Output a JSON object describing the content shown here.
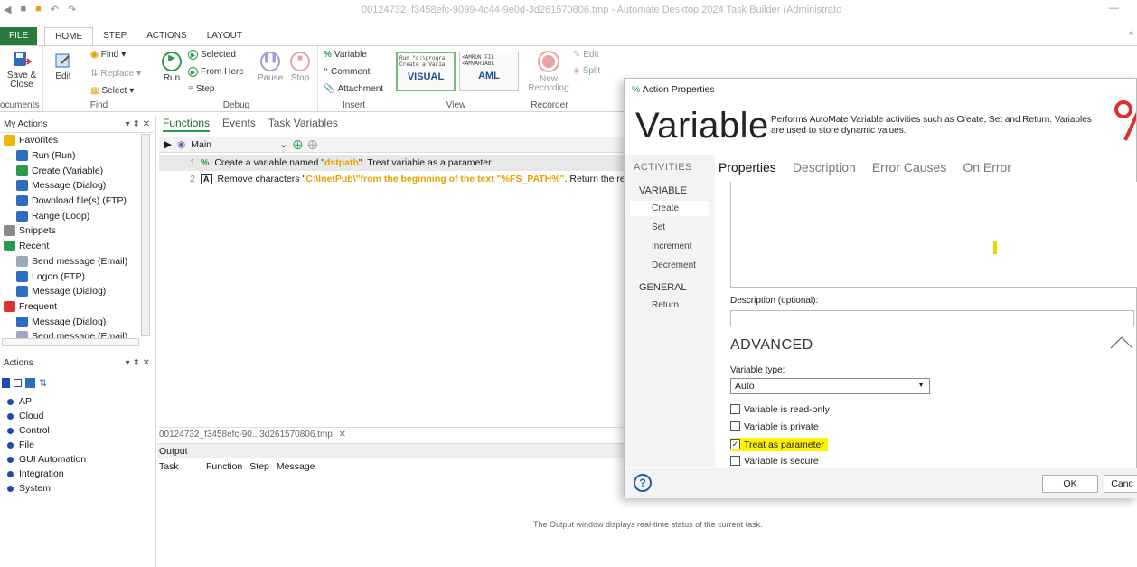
{
  "window": {
    "title": "00124732_f3458efc-9099-4c44-9e0d-3d261570806.tmp - Automate Desktop 2024 Task Builder (Administrator)",
    "minimize_glyph": "—"
  },
  "ribbon": {
    "tabs": [
      "FILE",
      "HOME",
      "STEP",
      "ACTIONS",
      "LAYOUT"
    ],
    "active_tab": "HOME",
    "collapse_glyph": "^",
    "documents": {
      "save_label": "Save &\nClose",
      "label": "ocuments"
    },
    "find": {
      "edit_label": "Edit",
      "find_label": "Find",
      "replace_label": "Replace",
      "select_label": "Select",
      "label": "Find"
    },
    "debug": {
      "run_label": "Run",
      "selected_label": "Selected",
      "from_here_label": "From Here",
      "step_label": "Step",
      "pause_label": "Pause",
      "stop_label": "Stop",
      "label": "Debug"
    },
    "insert": {
      "variable_label": "Variable",
      "comment_label": "Comment",
      "attachment_label": "Attachment",
      "label": "Insert"
    },
    "view": {
      "visual_snippet1": "Run \"c:\\progra",
      "visual_snippet2": "Create a Varia",
      "visual_label": "VISUAL",
      "aml_snippet1": "<AMRUN FIL",
      "aml_snippet2": "<AMVARIABL",
      "aml_label": "AML",
      "label": "View"
    },
    "recorder": {
      "new_label": "New\nRecording",
      "edit_label": "Edit",
      "split_label": "Split",
      "label": "Recorder"
    }
  },
  "my_actions": {
    "title": "My Actions",
    "pin_glyphs": "▾ ⬍ ✕",
    "items": [
      {
        "label": "Favorites",
        "level": 1,
        "icon": "star-icon"
      },
      {
        "label": "Run (Run)",
        "level": 2,
        "icon": "run-icon"
      },
      {
        "label": "Create (Variable)",
        "level": 2,
        "icon": "variable-icon"
      },
      {
        "label": "Message (Dialog)",
        "level": 2,
        "icon": "dialog-icon"
      },
      {
        "label": "Download file(s) (FTP)",
        "level": 2,
        "icon": "ftp-icon"
      },
      {
        "label": "Range (Loop)",
        "level": 2,
        "icon": "loop-icon"
      },
      {
        "label": "Snippets",
        "level": 1,
        "icon": "snippet-icon"
      },
      {
        "label": "Recent",
        "level": 1,
        "icon": "history-icon"
      },
      {
        "label": "Send message (Email)",
        "level": 2,
        "icon": "email-icon"
      },
      {
        "label": "Logon (FTP)",
        "level": 2,
        "icon": "ftp-icon"
      },
      {
        "label": "Message (Dialog)",
        "level": 2,
        "icon": "dialog-icon"
      },
      {
        "label": "Frequent",
        "level": 1,
        "icon": "pin-icon"
      },
      {
        "label": "Message (Dialog)",
        "level": 2,
        "icon": "dialog-icon"
      },
      {
        "label": "Send message (Email)",
        "level": 2,
        "icon": "email-icon"
      }
    ]
  },
  "actions_panel": {
    "title": "Actions",
    "items": [
      "API",
      "Cloud",
      "Control",
      "File",
      "GUI Automation",
      "Integration",
      "System"
    ]
  },
  "functions": {
    "tabs": [
      "Functions",
      "Events",
      "Task Variables"
    ],
    "active_tab": "Functions",
    "main_label": "Main",
    "steps": [
      {
        "num": "1",
        "pre": "Create a variable named \"",
        "highlight": "dstpath",
        "post": "\". Treat variable as a parameter."
      },
      {
        "num": "2",
        "pre": "Remove characters \"",
        "highlight": "C:\\InetPub\\\"from the beginning of the text \"%FS_PATH%\"",
        "post": ". Return the result t"
      }
    ],
    "doc_tab": "00124732_f3458efc-90...3d261570806.tmp"
  },
  "output": {
    "title": "Output",
    "columns": [
      "Task",
      "Function",
      "Step",
      "Message"
    ],
    "empty_message": "The Output window displays real-time status of the current task."
  },
  "dialog": {
    "title": "Action Properties",
    "heading": "Variable",
    "description": "Performs AutoMate Variable activities such as Create, Set and Return. Variables are used to store dynamic values.",
    "activities_header": "ACTIVITIES",
    "sections": [
      {
        "name": "VARIABLE",
        "items": [
          "Create",
          "Set",
          "Increment",
          "Decrement"
        ]
      },
      {
        "name": "GENERAL",
        "items": [
          "Return"
        ]
      }
    ],
    "selected_activity": "Create",
    "tabs": [
      "Properties",
      "Description",
      "Error Causes",
      "On Error"
    ],
    "active_tab": "Properties",
    "description_label": "Description (optional):",
    "description_value": "",
    "advanced_label": "ADVANCED",
    "variable_type_label": "Variable type:",
    "variable_type_value": "Auto",
    "checkboxes": [
      {
        "label": "Variable is read-only",
        "checked": false
      },
      {
        "label": "Variable is private",
        "checked": false
      },
      {
        "label": "Treat as parameter",
        "checked": true,
        "highlighted": true
      },
      {
        "label": "Variable is secure",
        "checked": false
      }
    ],
    "ok_label": "OK",
    "cancel_label": "Canc"
  },
  "colors": {
    "accent_green": "#2b7a3d",
    "highlight_orange": "#e8a200",
    "highlight_yellow": "#fff200",
    "logo_red": "#d93232"
  }
}
